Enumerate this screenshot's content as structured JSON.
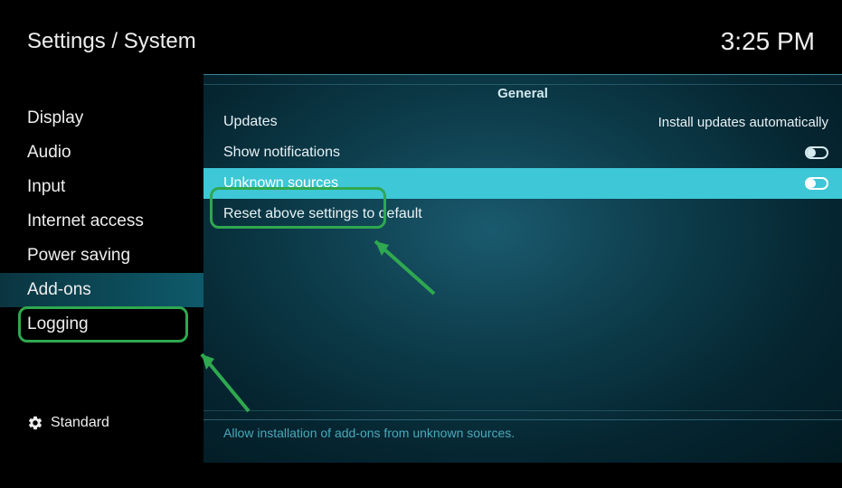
{
  "header": {
    "breadcrumb": "Settings / System",
    "clock": "3:25 PM"
  },
  "sidebar": {
    "items": [
      {
        "label": "Display"
      },
      {
        "label": "Audio"
      },
      {
        "label": "Input"
      },
      {
        "label": "Internet access"
      },
      {
        "label": "Power saving"
      },
      {
        "label": "Add-ons",
        "active": true
      },
      {
        "label": "Logging"
      }
    ],
    "footer_label": "Standard"
  },
  "main": {
    "section_title": "General",
    "rows": [
      {
        "label": "Updates",
        "value": "Install updates automatically",
        "type": "value"
      },
      {
        "label": "Show notifications",
        "type": "toggle",
        "on": false
      },
      {
        "label": "Unknown sources",
        "type": "toggle",
        "on": false,
        "highlighted": true
      },
      {
        "label": "Reset above settings to default",
        "type": "action"
      }
    ],
    "hint": "Allow installation of add-ons from unknown sources."
  }
}
